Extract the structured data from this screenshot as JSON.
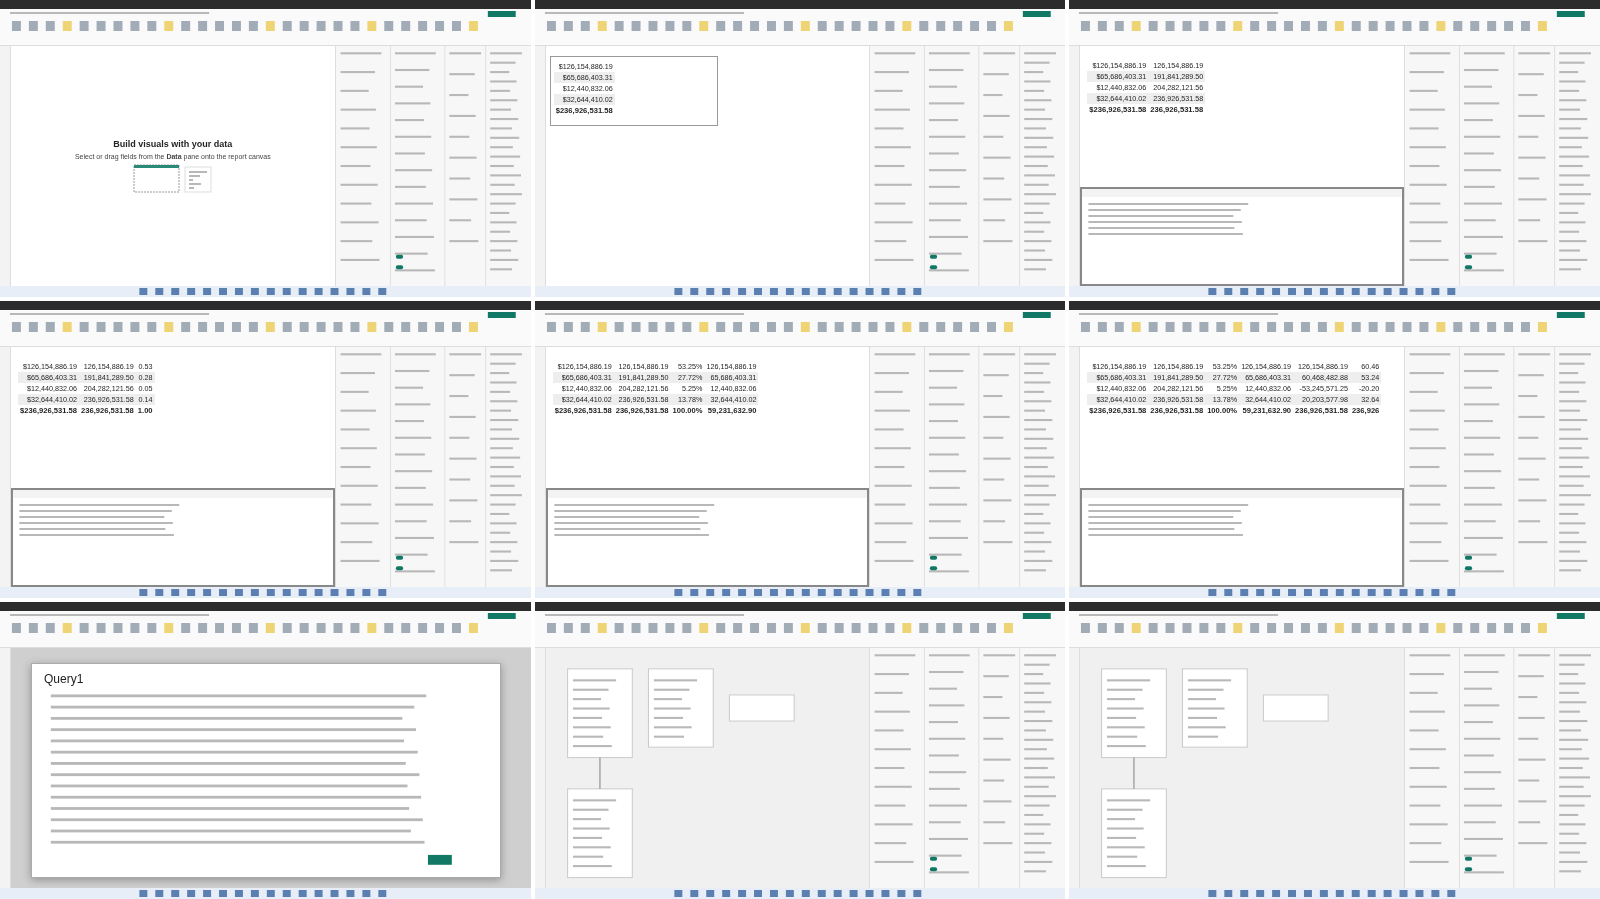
{
  "tiles": [
    {
      "kind": "empty",
      "heading": "Build visuals with your data",
      "hint": "Select or drag fields from the **Data** pane onto the report canvas"
    },
    {
      "kind": "table",
      "dax_pane": false,
      "selected_visual": true,
      "rows": [
        [
          "$126,154,886.19"
        ],
        [
          "$65,686,403.31"
        ],
        [
          "$12,440,832.06"
        ],
        [
          "$32,644,410.02"
        ]
      ],
      "total": [
        "$236,926,531.58"
      ]
    },
    {
      "kind": "table",
      "dax_pane": true,
      "selected_visual": false,
      "rows": [
        [
          "$126,154,886.19",
          "126,154,886.19"
        ],
        [
          "$65,686,403.31",
          "191,841,289.50"
        ],
        [
          "$12,440,832.06",
          "204,282,121.56"
        ],
        [
          "$32,644,410.02",
          "236,926,531.58"
        ]
      ],
      "total": [
        "$236,926,531.58",
        "236,926,531.58"
      ]
    },
    {
      "kind": "table",
      "dax_pane": true,
      "selected_visual": false,
      "rows": [
        [
          "$126,154,886.19",
          "126,154,886.19",
          "0.53"
        ],
        [
          "$65,686,403.31",
          "191,841,289.50",
          "0.28"
        ],
        [
          "$12,440,832.06",
          "204,282,121.56",
          "0.05"
        ],
        [
          "$32,644,410.02",
          "236,926,531.58",
          "0.14"
        ]
      ],
      "total": [
        "$236,926,531.58",
        "236,926,531.58",
        "1.00"
      ]
    },
    {
      "kind": "table",
      "dax_pane": true,
      "selected_visual": false,
      "rows": [
        [
          "$126,154,886.19",
          "126,154,886.19",
          "53.25%",
          "126,154,886.19"
        ],
        [
          "$65,686,403.31",
          "191,841,289.50",
          "27.72%",
          "65,686,403.31"
        ],
        [
          "$12,440,832.06",
          "204,282,121.56",
          "5.25%",
          "12,440,832.06"
        ],
        [
          "$32,644,410.02",
          "236,926,531.58",
          "13.78%",
          "32,644,410.02"
        ]
      ],
      "total": [
        "$236,926,531.58",
        "236,926,531.58",
        "100.00%",
        "59,231,632.90"
      ]
    },
    {
      "kind": "table",
      "dax_pane": true,
      "selected_visual": false,
      "rows": [
        [
          "$126,154,886.19",
          "126,154,886.19",
          "53.25%",
          "126,154,886.19",
          "126,154,886.19",
          "60.46"
        ],
        [
          "$65,686,403.31",
          "191,841,289.50",
          "27.72%",
          "65,686,403.31",
          "60,468,482.88",
          "53.24"
        ],
        [
          "$12,440,832.06",
          "204,282,121.56",
          "5.25%",
          "12,440,832.06",
          "-53,245,571.25",
          "-20.20"
        ],
        [
          "$32,644,410.02",
          "236,926,531.58",
          "13.78%",
          "32,644,410.02",
          "20,203,577.98",
          "32.64"
        ]
      ],
      "total": [
        "$236,926,531.58",
        "236,926,531.58",
        "100.00%",
        "59,231,632.90",
        "236,926,531.58",
        "236,926"
      ]
    },
    {
      "kind": "query",
      "title": "Query1"
    },
    {
      "kind": "model"
    },
    {
      "kind": "model"
    }
  ]
}
